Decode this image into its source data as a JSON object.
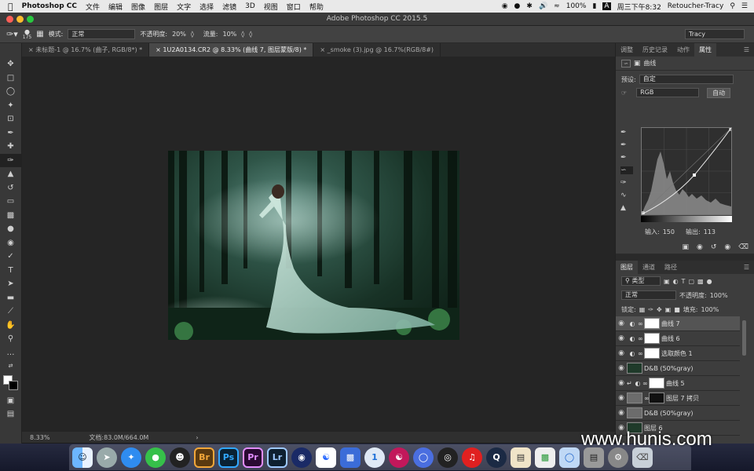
{
  "menubar": {
    "app": "Photoshop CC",
    "items": [
      "文件",
      "编辑",
      "图像",
      "图层",
      "文字",
      "选择",
      "滤镜",
      "3D",
      "视图",
      "窗口",
      "帮助"
    ],
    "battery": "100%",
    "input_method": "A",
    "clock": "周三下午8:32",
    "user": "Retoucher-Tracy"
  },
  "window": {
    "title": "Adobe Photoshop CC 2015.5"
  },
  "options_bar": {
    "brush_size": "175",
    "mode_label": "模式:",
    "mode_value": "正常",
    "opacity_label": "不透明度:",
    "opacity_value": "20%",
    "flow_label": "流量:",
    "flow_value": "10%",
    "workspace": "Tracy"
  },
  "tabs": [
    {
      "label": "未标题-1 @ 16.7% (曲子, RGB/8*) *"
    },
    {
      "label": "1U2A0134.CR2 @ 8.33% (曲线 7, 图层蒙版/8) *"
    },
    {
      "label": "_smoke (3).jpg @ 16.7%(RGB/8#)"
    }
  ],
  "status": {
    "zoom": "8.33%",
    "doc": "文档:83.0M/664.0M"
  },
  "panel_tabs": [
    "调整",
    "历史记录",
    "动作",
    "属性"
  ],
  "properties": {
    "title": "曲线",
    "preset_label": "预设:",
    "preset_value": "自定",
    "channel": "RGB",
    "auto_label": "自动",
    "input_label": "输入:",
    "input_value": "150",
    "output_label": "输出:",
    "output_value": "113"
  },
  "layers_tabs": [
    "图层",
    "通道",
    "路径"
  ],
  "layers_panel": {
    "kind": "类型",
    "blend": "正常",
    "opacity_label": "不透明度:",
    "opacity_value": "100%",
    "lock_label": "锁定:",
    "fill_label": "填充:",
    "fill_value": "100%"
  },
  "layers": [
    {
      "name": "曲线 7"
    },
    {
      "name": "曲线 6"
    },
    {
      "name": "选取颜色 1"
    },
    {
      "name": "D&B (50%gray)"
    },
    {
      "name": "曲线 5"
    },
    {
      "name": "图层 7 拷贝"
    },
    {
      "name": "D&B (50%gray)"
    },
    {
      "name": "图层 6"
    }
  ],
  "dock_apps": [
    "Finder",
    "Launchpad",
    "Safari",
    "WeChat",
    "QQ",
    "Br",
    "Ps",
    "Pr",
    "Lr",
    "Cinema",
    "Baidu",
    "Photos",
    "1Password",
    "DaVinci",
    "Browser",
    "OBS",
    "NetEase",
    "QuickTime",
    "Preview",
    "Numbers",
    "Keynote",
    "Desktop",
    "Settings",
    "Trash"
  ],
  "watermark": "www.hunis.com",
  "colors": {
    "accent": "#4a90d9",
    "ui_dark": "#3d3d3d"
  }
}
